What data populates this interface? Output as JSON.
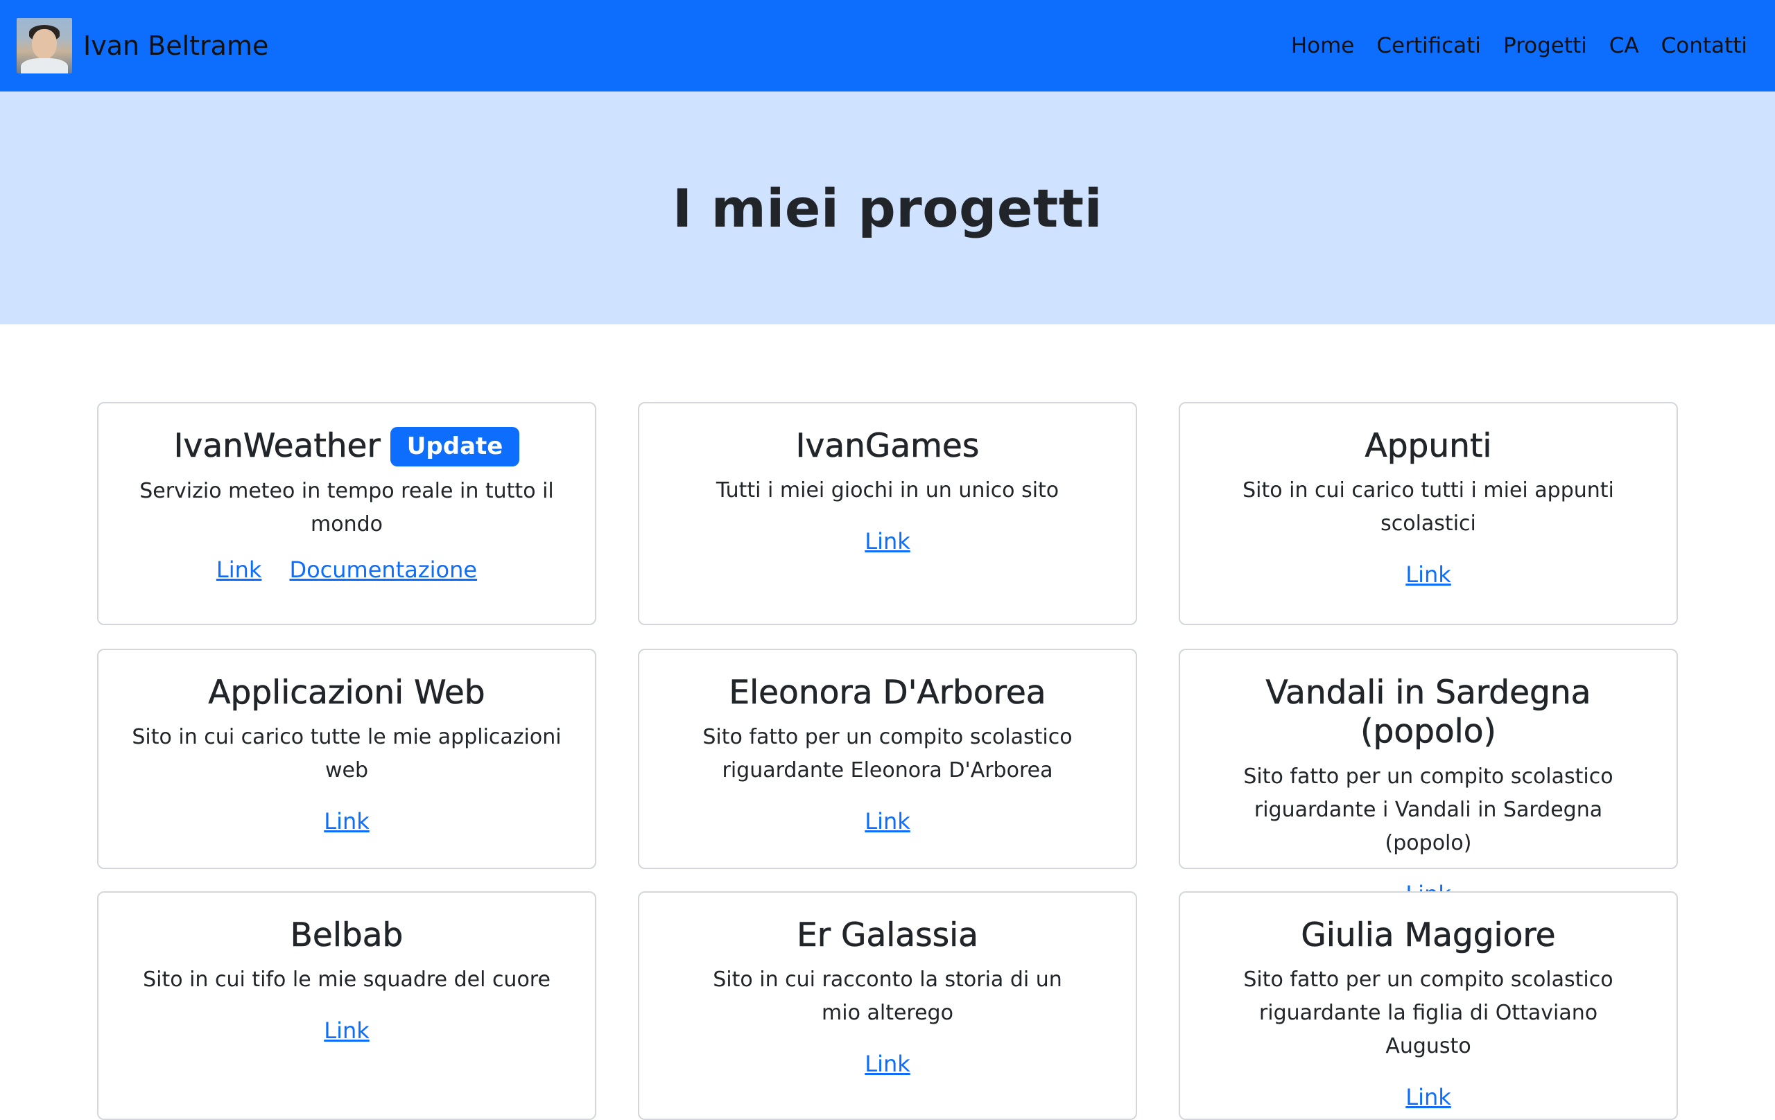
{
  "navbar": {
    "brand_name": "Ivan Beltrame",
    "links": [
      {
        "label": "Home"
      },
      {
        "label": "Certificati"
      },
      {
        "label": "Progetti"
      },
      {
        "label": "CA"
      },
      {
        "label": "Contatti"
      }
    ]
  },
  "hero": {
    "title": "I miei progetti"
  },
  "projects": [
    {
      "title": "IvanWeather",
      "badge": "Update",
      "description": "Servizio meteo in tempo reale in tutto il mondo",
      "links": [
        "Link",
        "Documentazione"
      ]
    },
    {
      "title": "IvanGames",
      "description": "Tutti i miei giochi in un unico sito",
      "links": [
        "Link"
      ]
    },
    {
      "title": "Appunti",
      "description": "Sito in cui carico tutti i miei appunti scolastici",
      "links": [
        "Link"
      ]
    },
    {
      "title": "Applicazioni Web",
      "description": "Sito in cui carico tutte le mie applicazioni web",
      "links": [
        "Link"
      ]
    },
    {
      "title": "Eleonora D'Arborea",
      "description": "Sito fatto per un compito scolastico riguardante Eleonora D'Arborea",
      "links": [
        "Link"
      ]
    },
    {
      "title": "Vandali in Sardegna (popolo)",
      "description": "Sito fatto per un compito scolastico riguardante i Vandali in Sardegna (popolo)",
      "links": [
        "Link"
      ]
    },
    {
      "title": "Belbab",
      "description": "Sito in cui tifo le mie squadre del cuore",
      "links": [
        "Link"
      ]
    },
    {
      "title": "Er Galassia",
      "description": "Sito in cui racconto la storia di un mio alterego",
      "links": [
        "Link"
      ]
    },
    {
      "title": "Giulia Maggiore",
      "description": "Sito fatto per un compito scolastico riguardante la figlia di Ottaviano Augusto",
      "links": [
        "Link"
      ]
    }
  ]
}
